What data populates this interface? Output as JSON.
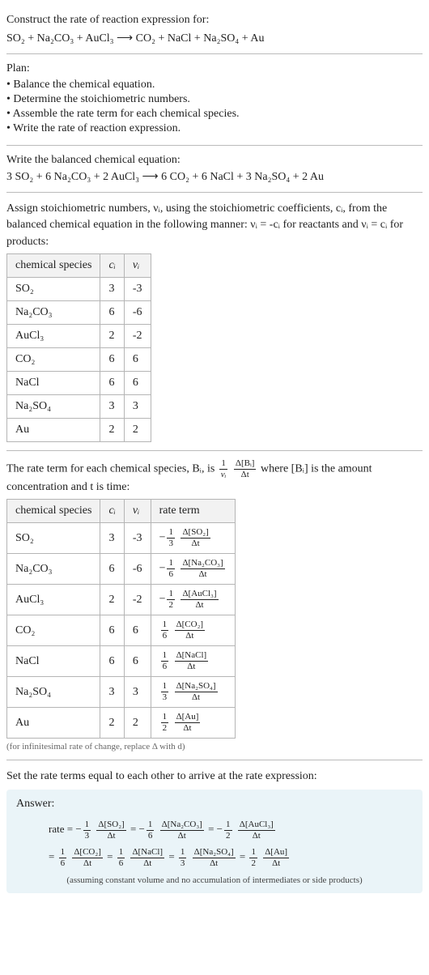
{
  "problem": {
    "intro": "Construct the rate of reaction expression for:",
    "equation": "SO₂ + Na₂CO₃ + AuCl₃ ⟶ CO₂ + NaCl + Na₂SO₄ + Au"
  },
  "plan": {
    "title": "Plan:",
    "items": [
      "Balance the chemical equation.",
      "Determine the stoichiometric numbers.",
      "Assemble the rate term for each chemical species.",
      "Write the rate of reaction expression."
    ]
  },
  "balanced": {
    "intro": "Write the balanced chemical equation:",
    "equation": "3 SO₂ + 6 Na₂CO₃ + 2 AuCl₃ ⟶ 6 CO₂ + 6 NaCl + 3 Na₂SO₄ + 2 Au"
  },
  "stoich": {
    "desc": "Assign stoichiometric numbers, νᵢ, using the stoichiometric coefficients, cᵢ, from the balanced chemical equation in the following manner: νᵢ = -cᵢ for reactants and νᵢ = cᵢ for products:",
    "headers": [
      "chemical species",
      "cᵢ",
      "νᵢ"
    ],
    "rows": [
      {
        "species": "SO₂",
        "c": "3",
        "v": "-3"
      },
      {
        "species": "Na₂CO₃",
        "c": "6",
        "v": "-6"
      },
      {
        "species": "AuCl₃",
        "c": "2",
        "v": "-2"
      },
      {
        "species": "CO₂",
        "c": "6",
        "v": "6"
      },
      {
        "species": "NaCl",
        "c": "6",
        "v": "6"
      },
      {
        "species": "Na₂SO₄",
        "c": "3",
        "v": "3"
      },
      {
        "species": "Au",
        "c": "2",
        "v": "2"
      }
    ]
  },
  "rate_terms": {
    "desc1": "The rate term for each chemical species, Bᵢ, is ",
    "desc1_frac_outer_num": "1",
    "desc1_frac_outer_den": "νᵢ",
    "desc1_frac_inner_num": "Δ[Bᵢ]",
    "desc1_frac_inner_den": "Δt",
    "desc2": " where [Bᵢ] is the amount concentration and t is time:",
    "headers": [
      "chemical species",
      "cᵢ",
      "νᵢ",
      "rate term"
    ],
    "rows": [
      {
        "species": "SO₂",
        "c": "3",
        "v": "-3",
        "sign": "−",
        "coef_num": "1",
        "coef_den": "3",
        "d_num": "Δ[SO₂]",
        "d_den": "Δt"
      },
      {
        "species": "Na₂CO₃",
        "c": "6",
        "v": "-6",
        "sign": "−",
        "coef_num": "1",
        "coef_den": "6",
        "d_num": "Δ[Na₂CO₃]",
        "d_den": "Δt"
      },
      {
        "species": "AuCl₃",
        "c": "2",
        "v": "-2",
        "sign": "−",
        "coef_num": "1",
        "coef_den": "2",
        "d_num": "Δ[AuCl₃]",
        "d_den": "Δt"
      },
      {
        "species": "CO₂",
        "c": "6",
        "v": "6",
        "sign": "",
        "coef_num": "1",
        "coef_den": "6",
        "d_num": "Δ[CO₂]",
        "d_den": "Δt"
      },
      {
        "species": "NaCl",
        "c": "6",
        "v": "6",
        "sign": "",
        "coef_num": "1",
        "coef_den": "6",
        "d_num": "Δ[NaCl]",
        "d_den": "Δt"
      },
      {
        "species": "Na₂SO₄",
        "c": "3",
        "v": "3",
        "sign": "",
        "coef_num": "1",
        "coef_den": "3",
        "d_num": "Δ[Na₂SO₄]",
        "d_den": "Δt"
      },
      {
        "species": "Au",
        "c": "2",
        "v": "2",
        "sign": "",
        "coef_num": "1",
        "coef_den": "2",
        "d_num": "Δ[Au]",
        "d_den": "Δt"
      }
    ],
    "note": "(for infinitesimal rate of change, replace Δ with d)"
  },
  "final": {
    "desc": "Set the rate terms equal to each other to arrive at the rate expression:"
  },
  "answer": {
    "title": "Answer:",
    "rate_label": "rate",
    "terms": [
      {
        "sign": "−",
        "num": "1",
        "den": "3",
        "dnum": "Δ[SO₂]",
        "dden": "Δt"
      },
      {
        "sign": "−",
        "num": "1",
        "den": "6",
        "dnum": "Δ[Na₂CO₃]",
        "dden": "Δt"
      },
      {
        "sign": "−",
        "num": "1",
        "den": "2",
        "dnum": "Δ[AuCl₃]",
        "dden": "Δt"
      },
      {
        "sign": "",
        "num": "1",
        "den": "6",
        "dnum": "Δ[CO₂]",
        "dden": "Δt"
      },
      {
        "sign": "",
        "num": "1",
        "den": "6",
        "dnum": "Δ[NaCl]",
        "dden": "Δt"
      },
      {
        "sign": "",
        "num": "1",
        "den": "3",
        "dnum": "Δ[Na₂SO₄]",
        "dden": "Δt"
      },
      {
        "sign": "",
        "num": "1",
        "den": "2",
        "dnum": "Δ[Au]",
        "dden": "Δt"
      }
    ],
    "note": "(assuming constant volume and no accumulation of intermediates or side products)"
  },
  "chart_data": {
    "type": "table",
    "tables": [
      {
        "title": "Stoichiometric numbers",
        "columns": [
          "chemical species",
          "c_i",
          "ν_i"
        ],
        "rows": [
          [
            "SO2",
            3,
            -3
          ],
          [
            "Na2CO3",
            6,
            -6
          ],
          [
            "AuCl3",
            2,
            -2
          ],
          [
            "CO2",
            6,
            6
          ],
          [
            "NaCl",
            6,
            6
          ],
          [
            "Na2SO4",
            3,
            3
          ],
          [
            "Au",
            2,
            2
          ]
        ]
      },
      {
        "title": "Rate terms",
        "columns": [
          "chemical species",
          "c_i",
          "ν_i",
          "rate term"
        ],
        "rows": [
          [
            "SO2",
            3,
            -3,
            "-(1/3) d[SO2]/dt"
          ],
          [
            "Na2CO3",
            6,
            -6,
            "-(1/6) d[Na2CO3]/dt"
          ],
          [
            "AuCl3",
            2,
            -2,
            "-(1/2) d[AuCl3]/dt"
          ],
          [
            "CO2",
            6,
            6,
            "(1/6) d[CO2]/dt"
          ],
          [
            "NaCl",
            6,
            6,
            "(1/6) d[NaCl]/dt"
          ],
          [
            "Na2SO4",
            3,
            3,
            "(1/3) d[Na2SO4]/dt"
          ],
          [
            "Au",
            2,
            2,
            "(1/2) d[Au]/dt"
          ]
        ]
      }
    ]
  }
}
